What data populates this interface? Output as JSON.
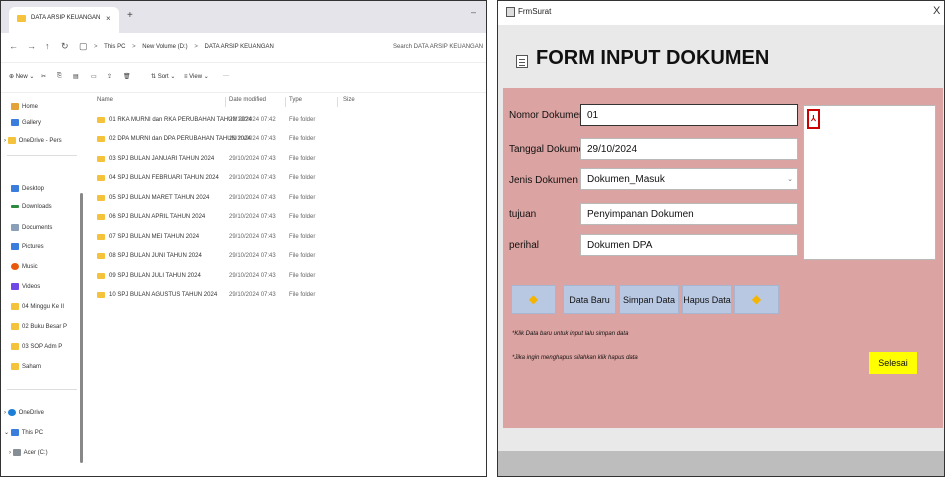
{
  "explorer": {
    "tab_title": "DATA ARSIP KEUANGAN",
    "tab_close": "×",
    "tab_new": "+",
    "window_min": "–",
    "nav": {
      "back": "←",
      "forward": "→",
      "up": "↑",
      "refresh": "↻",
      "monitor": "▢"
    },
    "breadcrumb": [
      "This PC",
      "New Volume (D:)",
      "DATA ARSIP KEUANGAN"
    ],
    "breadcrumb_sep": ">",
    "search_placeholder": "Search DATA ARSIP KEUANGAN",
    "toolbar": {
      "new": "⊕ New ⌄",
      "sort": "⇅ Sort ⌄",
      "view": "≡ View ⌄",
      "more": "···"
    },
    "sidebar": {
      "home": "Home",
      "gallery": "Gallery",
      "onedrive_personal": "OneDrive - Pers",
      "desktop": "Desktop",
      "downloads": "Downloads",
      "documents": "Documents",
      "pictures": "Pictures",
      "music": "Music",
      "videos": "Videos",
      "folder1": "04 Minggu Ke II",
      "folder2": "02 Buku Besar P",
      "folder3": "03 SOP Adm P",
      "folder4": "Saham",
      "onedrive": "OneDrive",
      "thispc": "This PC",
      "drive": "Acer (C:)"
    },
    "columns": {
      "name": "Name",
      "date": "Date modified",
      "type": "Type",
      "size": "Size"
    },
    "rows": [
      {
        "name": "01 RKA MURNI dan RKA PERUBAHAN TAHUN 2024",
        "date": "29/10/2024 07:42",
        "type": "File folder"
      },
      {
        "name": "02 DPA MURNI dan DPA PERUBAHAN TAHUN 2024",
        "date": "29/10/2024 07:43",
        "type": "File folder"
      },
      {
        "name": "03 SPJ BULAN JANUARI TAHUN 2024",
        "date": "29/10/2024 07:43",
        "type": "File folder"
      },
      {
        "name": "04 SPJ BULAN FEBRUARI TAHUN 2024",
        "date": "29/10/2024 07:43",
        "type": "File folder"
      },
      {
        "name": "05 SPJ BULAN MARET TAHUN 2024",
        "date": "29/10/2024 07:43",
        "type": "File folder"
      },
      {
        "name": "06 SPJ BULAN APRIL TAHUN 2024",
        "date": "29/10/2024 07:43",
        "type": "File folder"
      },
      {
        "name": "07 SPJ BULAN MEI TAHUN 2024",
        "date": "29/10/2024 07:43",
        "type": "File folder"
      },
      {
        "name": "08 SPJ BULAN JUNI TAHUN 2024",
        "date": "29/10/2024 07:43",
        "type": "File folder"
      },
      {
        "name": "09 SPJ BULAN JULI TAHUN 2024",
        "date": "29/10/2024 07:43",
        "type": "File folder"
      },
      {
        "name": "10 SPJ BULAN AGUSTUS TAHUN 2024",
        "date": "29/10/2024 07:43",
        "type": "File folder"
      }
    ]
  },
  "form": {
    "window_title": "FrmSurat",
    "close": "X",
    "header": "FORM INPUT DOKUMEN",
    "labels": {
      "nomor": "Nomor Dokumen",
      "tanggal": "Tanggal Dokumen",
      "jenis": "Jenis Dokumen",
      "tujuan": "tujuan",
      "perihal": "perihal"
    },
    "values": {
      "nomor": "01",
      "tanggal": "29/10/2024",
      "jenis": "Dokumen_Masuk",
      "tujuan": "Penyimpanan Dokumen",
      "perihal": "Dokumen DPA"
    },
    "dropdown_arrow": "⌄",
    "pdf_icon": "⅄",
    "buttons": {
      "prev": "◆",
      "data_baru": "Data Baru",
      "simpan": "Simpan Data",
      "hapus": "Hapus Data",
      "next": "◆",
      "selesai": "Selesai"
    },
    "notes": {
      "note1": "*Klik Data baru untuk input lalu simpan data",
      "note2": "*Jika ingin menghapus silahkan klik hapus data"
    },
    "colors": {
      "body": "#dba3a1",
      "button": "#b9c8e2",
      "selesai": "#ffff00",
      "arrow": "#f4b400"
    }
  }
}
